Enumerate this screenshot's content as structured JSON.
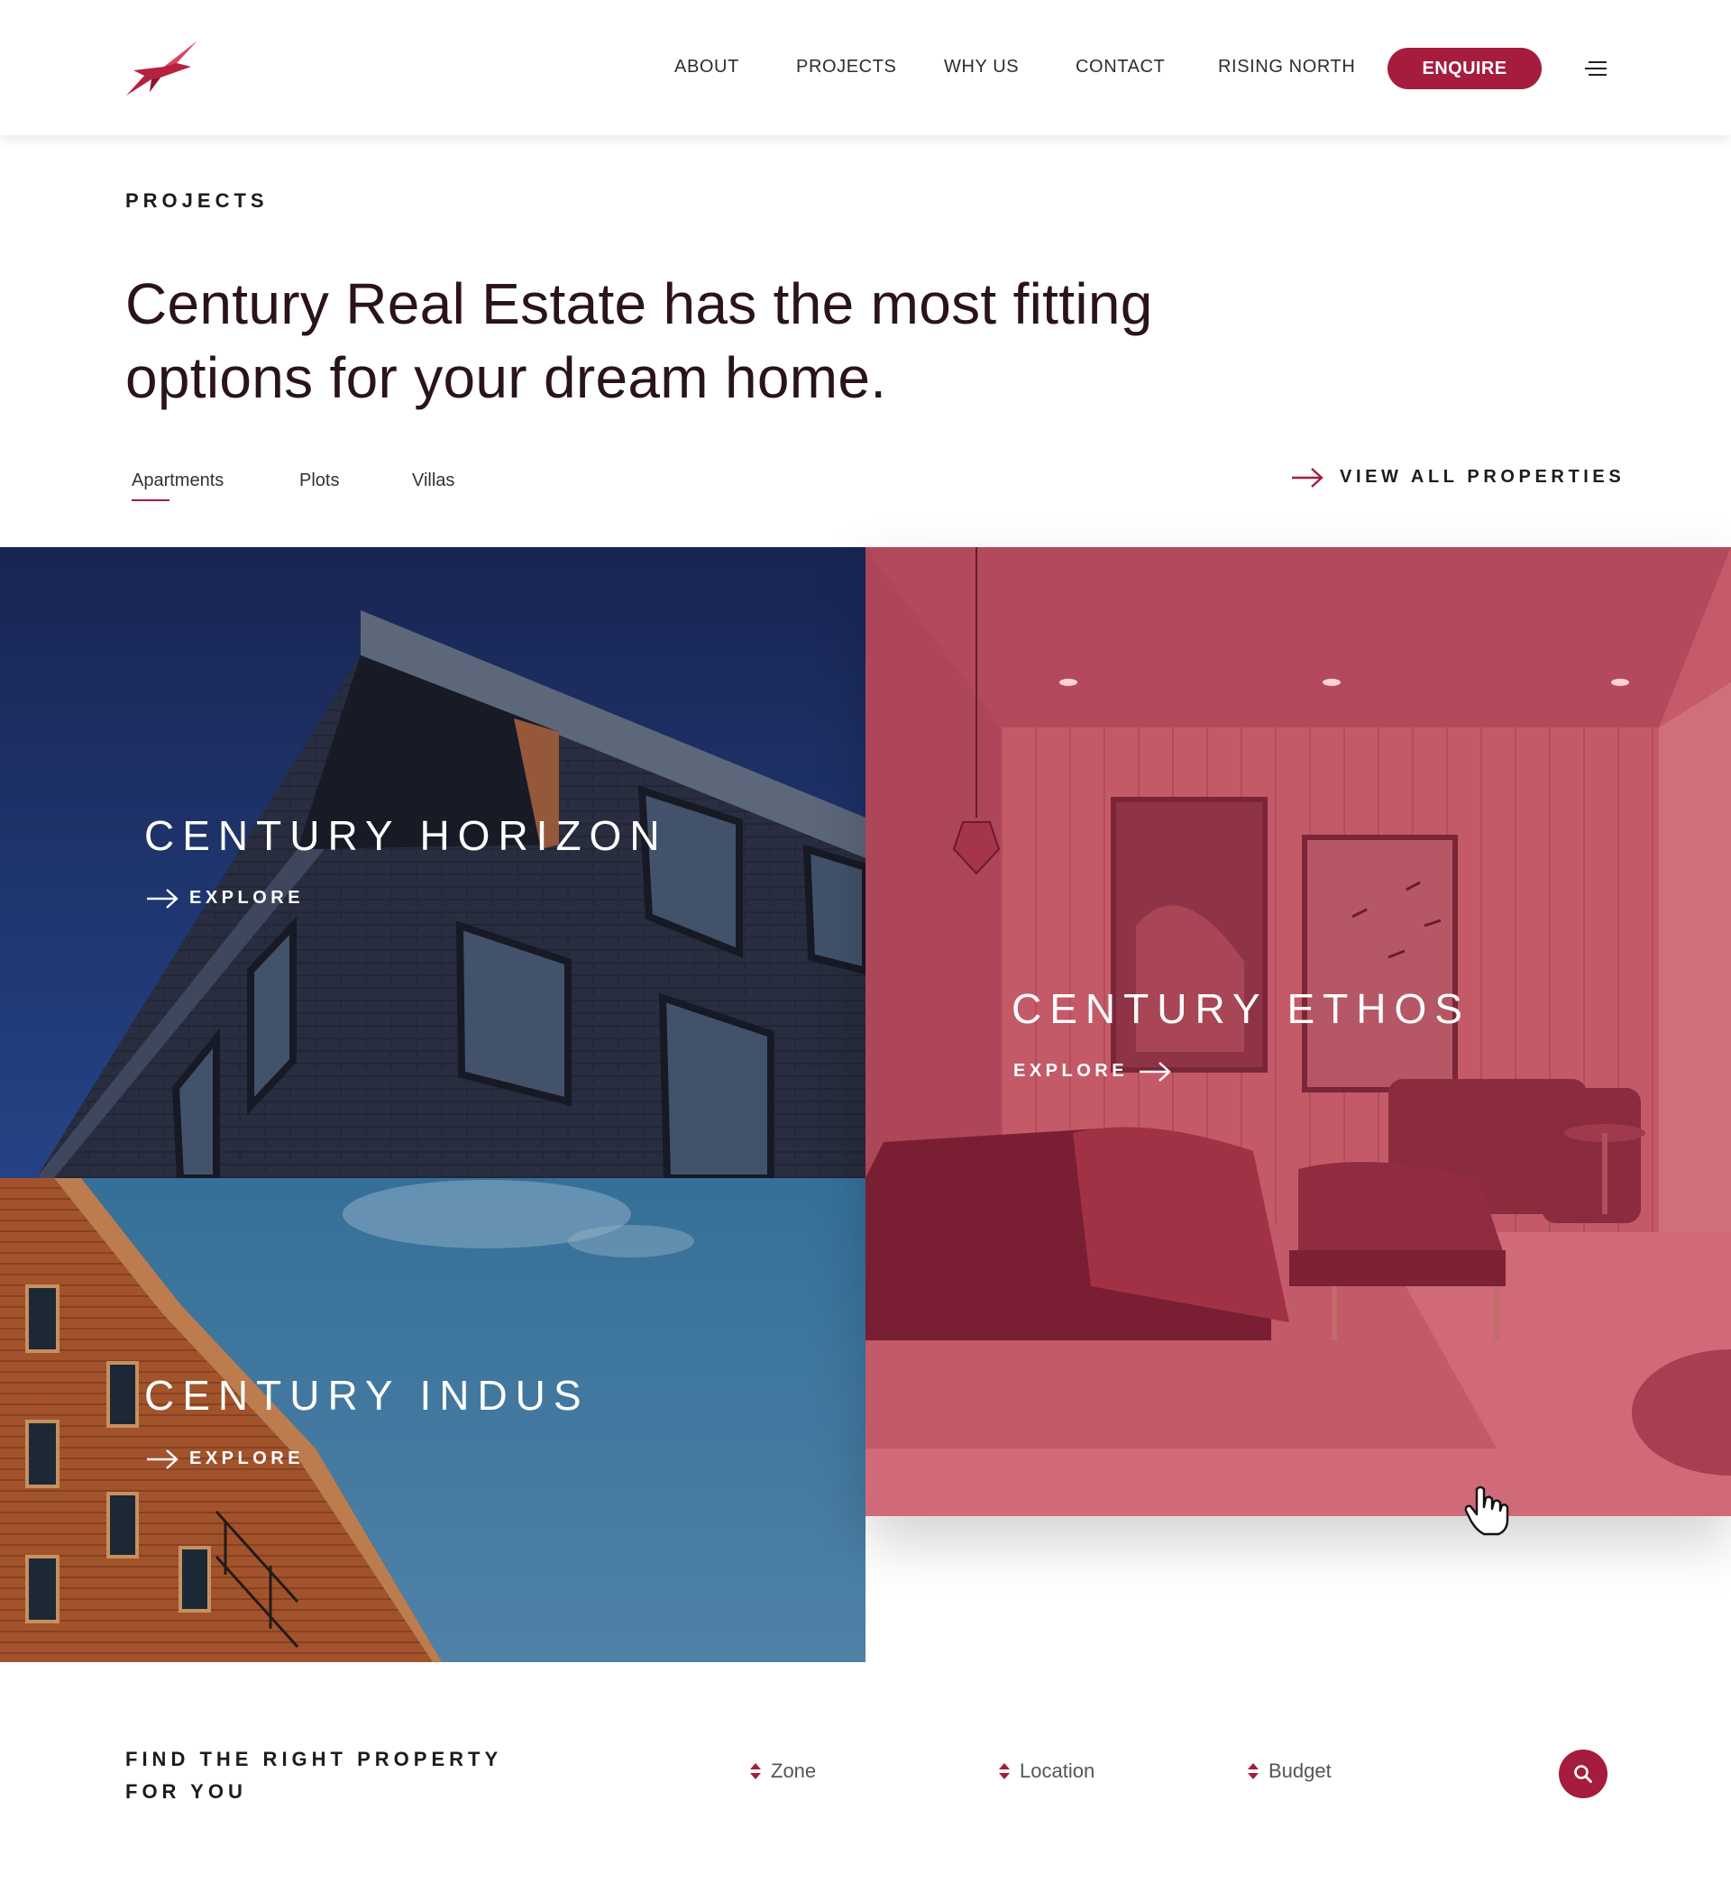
{
  "brand": {
    "accent": "#a51c3d",
    "logo": "century-star-logo"
  },
  "nav": {
    "items": [
      "ABOUT",
      "PROJECTS",
      "WHY US",
      "CONTACT",
      "RISING NORTH"
    ],
    "cta": "ENQUIRE",
    "menu_icon": "hamburger-menu-icon"
  },
  "projects": {
    "eyebrow": "PROJECTS",
    "headline_line1": "Century Real Estate has the most fitting",
    "headline_line2": "options for your dream home.",
    "tabs": [
      "Apartments",
      "Plots",
      "Villas"
    ],
    "active_tab": "Apartments",
    "view_all": "VIEW ALL PROPERTIES",
    "tiles": [
      {
        "title": "CENTURY HORIZON",
        "cta": "EXPLORE"
      },
      {
        "title": "CENTURY ETHOS",
        "cta": "EXPLORE"
      },
      {
        "title": "CENTURY INDUS",
        "cta": "EXPLORE"
      }
    ]
  },
  "finder": {
    "title_line1": "FIND THE RIGHT PROPERTY",
    "title_line2": "FOR YOU",
    "filters": [
      "Zone",
      "Location",
      "Budget"
    ],
    "search_icon": "search-icon"
  }
}
